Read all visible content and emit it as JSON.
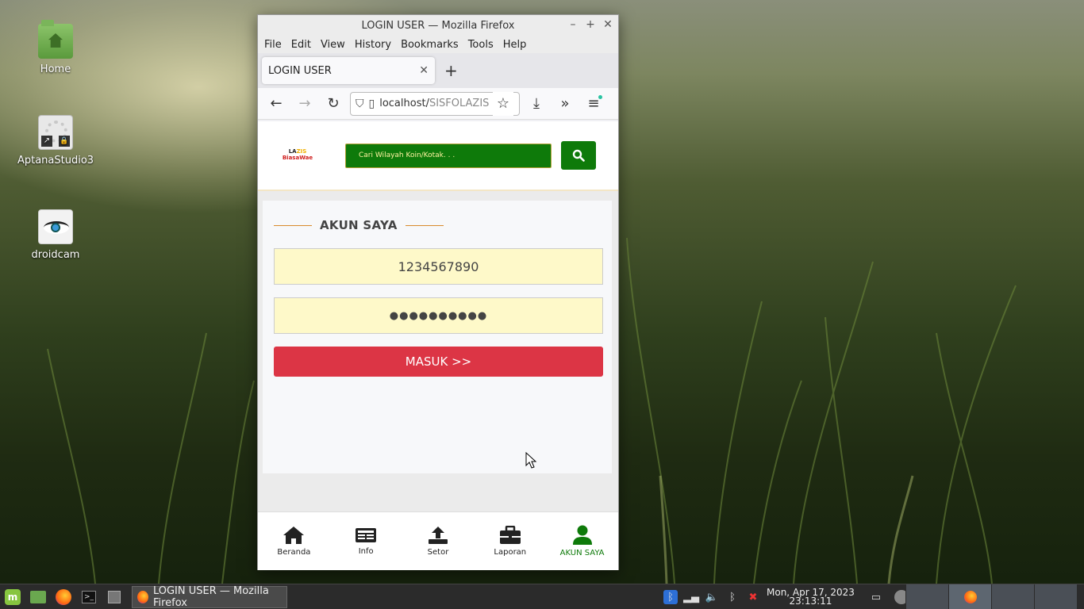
{
  "desktop": {
    "icons": [
      {
        "label": "Home"
      },
      {
        "label": "AptanaStudio3"
      },
      {
        "label": "droidcam"
      }
    ]
  },
  "window": {
    "title": "LOGIN USER — Mozilla Firefox",
    "menu": [
      "File",
      "Edit",
      "View",
      "History",
      "Bookmarks",
      "Tools",
      "Help"
    ],
    "tab": {
      "label": "LOGIN USER"
    },
    "url": {
      "host": "localhost/",
      "path": "SISFOLAZIS"
    }
  },
  "page": {
    "logo": {
      "line1_a": "LA",
      "line1_b": "ZIS",
      "line2": "BiasaWae"
    },
    "search": {
      "placeholder": "Cari Wilayah Koin/Kotak. . ."
    },
    "section_title": "AKUN SAYA",
    "username_value": "1234567890",
    "password_value": "●●●●●●●●●●",
    "login_button": "MASUK >>",
    "bottom_nav": [
      {
        "label": "Beranda",
        "icon": "home-icon"
      },
      {
        "label": "Info",
        "icon": "newspaper-icon"
      },
      {
        "label": "Setor",
        "icon": "upload-icon"
      },
      {
        "label": "Laporan",
        "icon": "briefcase-icon"
      },
      {
        "label": "AKUN SAYA",
        "icon": "user-icon"
      }
    ],
    "accent_color": "#0e7a0a",
    "button_color": "#dc3545"
  },
  "taskbar": {
    "window_label": "LOGIN USER — Mozilla Firefox",
    "clock_date": "Mon, Apr 17, 2023",
    "clock_time": "23:13:11"
  }
}
